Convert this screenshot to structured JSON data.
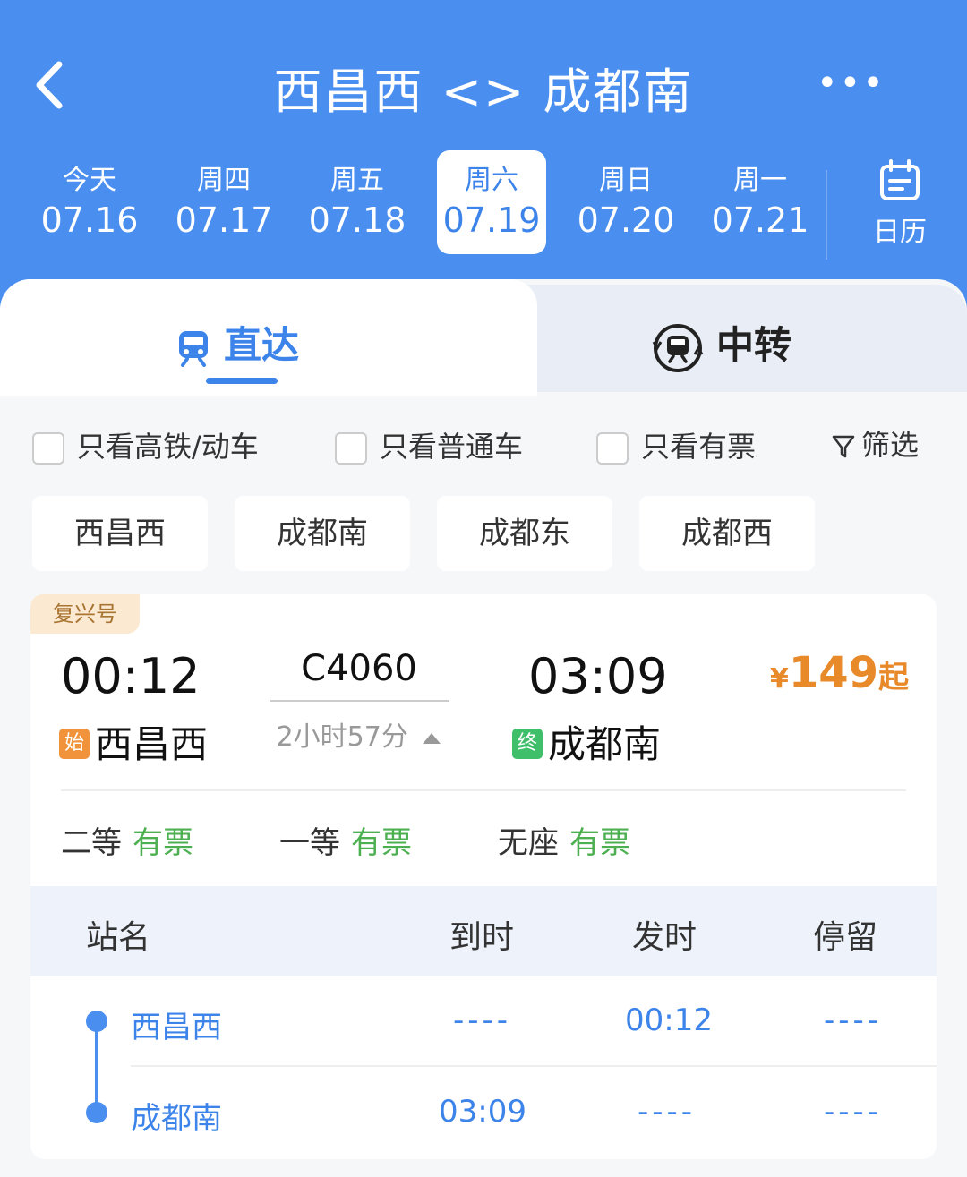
{
  "header": {
    "title": "西昌西 <> 成都南",
    "more": "•••",
    "calendar_label": "日历",
    "dates": [
      {
        "weekday": "今天",
        "date": "07.16"
      },
      {
        "weekday": "周四",
        "date": "07.17"
      },
      {
        "weekday": "周五",
        "date": "07.18"
      },
      {
        "weekday": "周六",
        "date": "07.19"
      },
      {
        "weekday": "周日",
        "date": "07.20"
      },
      {
        "weekday": "周一",
        "date": "07.21"
      }
    ],
    "selected_date_index": 3
  },
  "tabs": {
    "direct": "直达",
    "transfer": "中转",
    "active": "direct"
  },
  "filters": {
    "highspeed_only": "只看高铁/动车",
    "normal_only": "只看普通车",
    "available_only": "只看有票",
    "filter_button": "筛选"
  },
  "stations": [
    "西昌西",
    "成都南",
    "成都东",
    "成都西"
  ],
  "train": {
    "badge": "复兴号",
    "depart_time": "00:12",
    "depart_station": "西昌西",
    "depart_tag": "始",
    "number": "C4060",
    "duration": "2小时57分",
    "arrive_time": "03:09",
    "arrive_station": "成都南",
    "arrive_tag": "终",
    "price_currency": "¥",
    "price": "149",
    "price_suffix": "起",
    "seats": [
      {
        "type": "二等",
        "status": "有票"
      },
      {
        "type": "一等",
        "status": "有票"
      },
      {
        "type": "无座",
        "status": "有票"
      }
    ]
  },
  "stop_table": {
    "headers": {
      "station": "站名",
      "arrive": "到时",
      "depart": "发时",
      "stay": "停留"
    },
    "rows": [
      {
        "station": "西昌西",
        "arrive": "----",
        "depart": "00:12",
        "stay": "----"
      },
      {
        "station": "成都南",
        "arrive": "03:09",
        "depart": "----",
        "stay": "----"
      }
    ]
  },
  "colors": {
    "header_blue": "#4a8ff0",
    "accent_blue": "#3d84ea",
    "price_orange": "#e8892a",
    "available_green": "#4caf50",
    "start_tag": "#f0933a",
    "end_tag": "#3fbf6a"
  }
}
